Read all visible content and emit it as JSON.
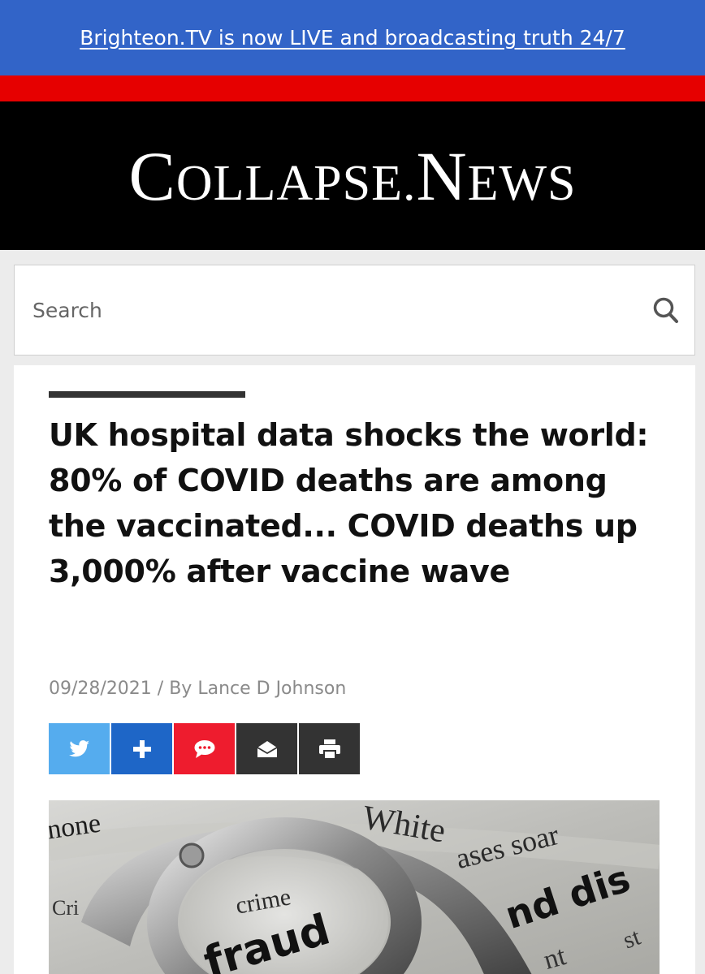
{
  "promo": {
    "text": "Brighteon.TV is now LIVE and broadcasting truth 24/7"
  },
  "masthead": {
    "logo_first": "C",
    "logo_rest": "OLLAPSE.",
    "logo_n": "N",
    "logo_tail": "EWS"
  },
  "search": {
    "placeholder": "Search",
    "icon": "search-icon"
  },
  "article": {
    "headline": "UK hospital data shocks the world: 80% of COVID deaths are among the vaccinated... COVID deaths up 3,000% after vaccine wave",
    "date": "09/28/2021",
    "separator": " / ",
    "byline": "By Lance D Johnson",
    "share_buttons": [
      {
        "icon": "twitter-icon",
        "color": "#55acee"
      },
      {
        "icon": "plus-icon",
        "color": "#1e66c7"
      },
      {
        "icon": "comment-icon",
        "color": "#ee1c2e"
      },
      {
        "icon": "email-icon",
        "color": "#333333"
      },
      {
        "icon": "print-icon",
        "color": "#333333"
      }
    ],
    "image_words": {
      "w1": "none",
      "w2": "White",
      "w3": "ases soar",
      "w4": "crime",
      "w5": "fraud",
      "w6": "nd dis",
      "w7": "Cri",
      "w8": "nt",
      "w9": "st"
    }
  }
}
